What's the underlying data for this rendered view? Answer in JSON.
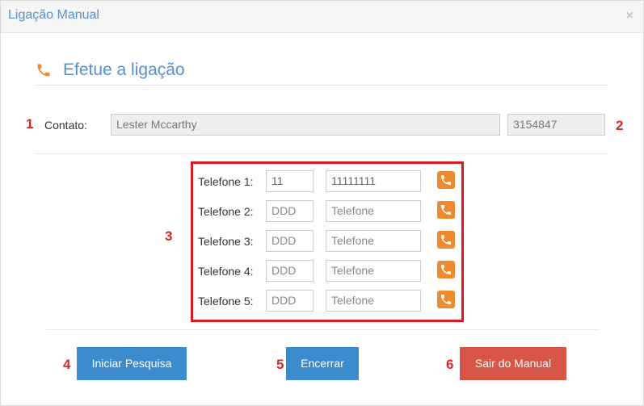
{
  "modal": {
    "title": "Ligação Manual",
    "close_label": "×"
  },
  "section": {
    "heading": "Efetue a ligação",
    "icon": "phone-icon"
  },
  "contact": {
    "label": "Contato:",
    "name_value": "Lester Mccarthy",
    "id_value": "3154847"
  },
  "phones": [
    {
      "label": "Telefone 1:",
      "ddd": "11",
      "number": "11111111",
      "filled": true
    },
    {
      "label": "Telefone 2:",
      "ddd": "DDD",
      "number": "Telefone",
      "filled": false
    },
    {
      "label": "Telefone 3:",
      "ddd": "DDD",
      "number": "Telefone",
      "filled": false
    },
    {
      "label": "Telefone 4:",
      "ddd": "DDD",
      "number": "Telefone",
      "filled": false
    },
    {
      "label": "Telefone 5:",
      "ddd": "DDD",
      "number": "Telefone",
      "filled": false
    }
  ],
  "buttons": {
    "start_search": "Iniciar Pesquisa",
    "end": "Encerrar",
    "exit_manual": "Sair do Manual"
  },
  "annotations": [
    "1",
    "2",
    "3",
    "4",
    "5",
    "6"
  ],
  "colors": {
    "accent_blue": "#3c8ccd",
    "exit_red": "#d75546",
    "call_orange": "#f08a2f",
    "annotation_red": "#e02424",
    "title_blue": "#5b8ec8"
  }
}
